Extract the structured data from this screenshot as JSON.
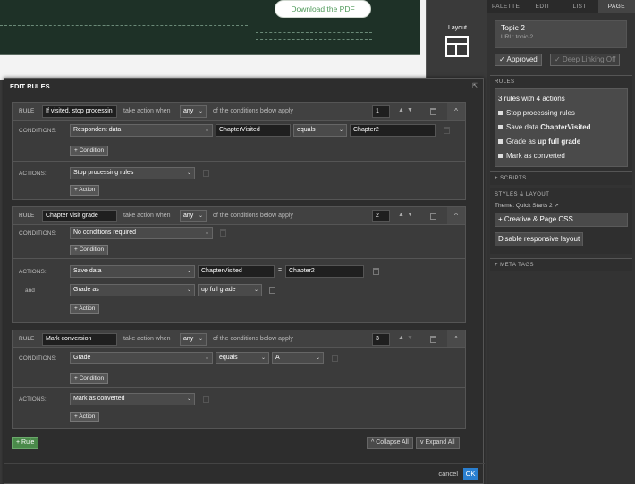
{
  "canvas": {
    "download_label": "Download the PDF"
  },
  "left_panel": {
    "layout_label": "Layout"
  },
  "right_panel": {
    "tabs": [
      "PALETTE",
      "EDIT",
      "LIST",
      "PAGE"
    ],
    "topic_title": "Topic 2",
    "topic_url": "URL: topic-2",
    "approved_label": "✓  Approved",
    "deeplink_label": "✓  Deep Linking Off",
    "rules_header": "RULES",
    "rules_summary": "3 rules with 4 actions",
    "rules_items": [
      {
        "text": "Stop processing rules",
        "bold": ""
      },
      {
        "text": "Save data ",
        "bold": "ChapterVisited"
      },
      {
        "text": "Grade as ",
        "bold": "up full grade"
      },
      {
        "text": "Mark as converted",
        "bold": ""
      }
    ],
    "scripts_header": "+ SCRIPTS",
    "styles_header": "STYLES & LAYOUT",
    "theme_label": "Theme: Quick Starts 2",
    "creative_css_label": "+ Creative & Page CSS",
    "disable_responsive_label": "Disable responsive layout",
    "meta_header": "+ META TAGS"
  },
  "modal": {
    "title": "EDIT RULES",
    "rule_label": "RULE",
    "take_action_when": "take action when",
    "of_conditions": "of the conditions below apply",
    "conditions_label": "CONDITIONS:",
    "actions_label": "ACTIONS:",
    "and_label": "and",
    "add_condition": "+ Condition",
    "add_action": "+ Action",
    "rules": [
      {
        "name": "If visited, stop processin",
        "match": "any",
        "number": "1",
        "conditions": [
          {
            "field": "Respondent data",
            "key": "ChapterVisited",
            "op": "equals",
            "value": "Chapter2"
          }
        ],
        "actions": [
          {
            "type": "Stop processing rules"
          }
        ]
      },
      {
        "name": "Chapter visit grade",
        "match": "any",
        "number": "2",
        "conditions": [
          {
            "field": "No conditions required"
          }
        ],
        "actions": [
          {
            "type": "Save data",
            "key": "ChapterVisited",
            "eq": "=",
            "value": "Chapter2"
          },
          {
            "type": "Grade as",
            "value": "up full grade"
          }
        ]
      },
      {
        "name": "Mark conversion",
        "match": "any",
        "number": "3",
        "conditions": [
          {
            "field": "Grade",
            "op": "equals",
            "value": "A"
          }
        ],
        "actions": [
          {
            "type": "Mark as converted"
          }
        ]
      }
    ],
    "add_rule": "+ Rule",
    "collapse_all": "^ Collapse All",
    "expand_all": "v Expand All",
    "cancel": "cancel",
    "ok": "OK"
  }
}
